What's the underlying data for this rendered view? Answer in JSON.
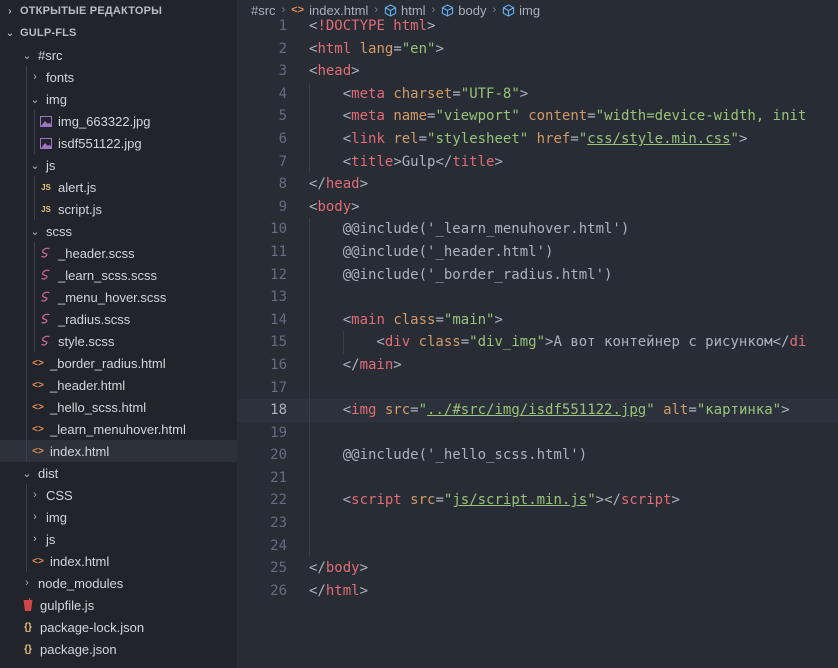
{
  "sidebar": {
    "open_editors_label": "ОТКРЫТЫЕ РЕДАКТОРЫ",
    "project_label": "GULP-FLS",
    "tree": [
      {
        "label": "#src",
        "depth": 1,
        "kind": "folder-open"
      },
      {
        "label": "fonts",
        "depth": 2,
        "kind": "folder-closed"
      },
      {
        "label": "img",
        "depth": 2,
        "kind": "folder-open"
      },
      {
        "label": "img_663322.jpg",
        "depth": 3,
        "kind": "image"
      },
      {
        "label": "isdf551122.jpg",
        "depth": 3,
        "kind": "image"
      },
      {
        "label": "js",
        "depth": 2,
        "kind": "folder-open"
      },
      {
        "label": "alert.js",
        "depth": 3,
        "kind": "js"
      },
      {
        "label": "script.js",
        "depth": 3,
        "kind": "js"
      },
      {
        "label": "scss",
        "depth": 2,
        "kind": "folder-open"
      },
      {
        "label": "_header.scss",
        "depth": 3,
        "kind": "scss"
      },
      {
        "label": "_learn_scss.scss",
        "depth": 3,
        "kind": "scss"
      },
      {
        "label": "_menu_hover.scss",
        "depth": 3,
        "kind": "scss"
      },
      {
        "label": "_radius.scss",
        "depth": 3,
        "kind": "scss"
      },
      {
        "label": "style.scss",
        "depth": 3,
        "kind": "scss"
      },
      {
        "label": "_border_radius.html",
        "depth": 2,
        "kind": "html"
      },
      {
        "label": "_header.html",
        "depth": 2,
        "kind": "html"
      },
      {
        "label": "_hello_scss.html",
        "depth": 2,
        "kind": "html"
      },
      {
        "label": "_learn_menuhover.html",
        "depth": 2,
        "kind": "html"
      },
      {
        "label": "index.html",
        "depth": 2,
        "kind": "html",
        "selected": true
      },
      {
        "label": "dist",
        "depth": 1,
        "kind": "folder-open"
      },
      {
        "label": "CSS",
        "depth": 2,
        "kind": "folder-closed"
      },
      {
        "label": "img",
        "depth": 2,
        "kind": "folder-closed"
      },
      {
        "label": "js",
        "depth": 2,
        "kind": "folder-closed"
      },
      {
        "label": "index.html",
        "depth": 2,
        "kind": "html"
      },
      {
        "label": "node_modules",
        "depth": 1,
        "kind": "folder-closed"
      },
      {
        "label": "gulpfile.js",
        "depth": 1,
        "kind": "gulp"
      },
      {
        "label": "package-lock.json",
        "depth": 1,
        "kind": "json"
      },
      {
        "label": "package.json",
        "depth": 1,
        "kind": "json"
      }
    ]
  },
  "breadcrumb": {
    "items": [
      {
        "label": "#src",
        "icon": "none"
      },
      {
        "label": "index.html",
        "icon": "html-icon"
      },
      {
        "label": "html",
        "icon": "cube-icon"
      },
      {
        "label": "body",
        "icon": "cube-icon"
      },
      {
        "label": "img",
        "icon": "cube-icon"
      }
    ]
  },
  "editor": {
    "current_line": 18,
    "lines": [
      {
        "n": "1",
        "tokens": [
          [
            "p",
            "<"
          ],
          [
            "t",
            "!DOCTYPE html"
          ],
          [
            "p",
            ">"
          ]
        ]
      },
      {
        "n": "2",
        "tokens": [
          [
            "p",
            "<"
          ],
          [
            "t",
            "html "
          ],
          [
            "a",
            "lang"
          ],
          [
            "p",
            "="
          ],
          [
            "s",
            "\"en\""
          ],
          [
            "p",
            ">"
          ]
        ]
      },
      {
        "n": "3",
        "tokens": [
          [
            "p",
            "<"
          ],
          [
            "t",
            "head"
          ],
          [
            "p",
            ">"
          ]
        ]
      },
      {
        "n": "4",
        "tokens": [
          [
            "p",
            "    <"
          ],
          [
            "t",
            "meta "
          ],
          [
            "a",
            "charset"
          ],
          [
            "p",
            "="
          ],
          [
            "s",
            "\"UTF-8\""
          ],
          [
            "p",
            ">"
          ]
        ]
      },
      {
        "n": "5",
        "tokens": [
          [
            "p",
            "    <"
          ],
          [
            "t",
            "meta "
          ],
          [
            "a",
            "name"
          ],
          [
            "p",
            "="
          ],
          [
            "s",
            "\"viewport\""
          ],
          [
            "p",
            " "
          ],
          [
            "a",
            "content"
          ],
          [
            "p",
            "="
          ],
          [
            "s",
            "\"width=device-width, init"
          ]
        ]
      },
      {
        "n": "6",
        "tokens": [
          [
            "p",
            "    <"
          ],
          [
            "t",
            "link "
          ],
          [
            "a",
            "rel"
          ],
          [
            "p",
            "="
          ],
          [
            "s",
            "\"stylesheet\""
          ],
          [
            "p",
            " "
          ],
          [
            "a",
            "href"
          ],
          [
            "p",
            "="
          ],
          [
            "s",
            "\""
          ],
          [
            "u",
            "css/style.min.css"
          ],
          [
            "s",
            "\""
          ],
          [
            "p",
            ">"
          ]
        ]
      },
      {
        "n": "7",
        "tokens": [
          [
            "p",
            "    <"
          ],
          [
            "t",
            "title"
          ],
          [
            "p",
            ">Gulp</"
          ],
          [
            "t",
            "title"
          ],
          [
            "p",
            ">"
          ]
        ]
      },
      {
        "n": "8",
        "tokens": [
          [
            "p",
            "</"
          ],
          [
            "t",
            "head"
          ],
          [
            "p",
            ">"
          ]
        ]
      },
      {
        "n": "9",
        "tokens": [
          [
            "p",
            "<"
          ],
          [
            "t",
            "body"
          ],
          [
            "p",
            ">"
          ]
        ]
      },
      {
        "n": "10",
        "tokens": [
          [
            "p",
            "    @@include('_learn_menuhover.html')"
          ]
        ]
      },
      {
        "n": "11",
        "tokens": [
          [
            "p",
            "    @@include('_header.html')"
          ]
        ]
      },
      {
        "n": "12",
        "tokens": [
          [
            "p",
            "    @@include('_border_radius.html')"
          ]
        ]
      },
      {
        "n": "13",
        "tokens": []
      },
      {
        "n": "14",
        "tokens": [
          [
            "p",
            "    <"
          ],
          [
            "t",
            "main "
          ],
          [
            "a",
            "class"
          ],
          [
            "p",
            "="
          ],
          [
            "s",
            "\"main\""
          ],
          [
            "p",
            ">"
          ]
        ]
      },
      {
        "n": "15",
        "tokens": [
          [
            "p",
            "        <"
          ],
          [
            "t",
            "div "
          ],
          [
            "a",
            "class"
          ],
          [
            "p",
            "="
          ],
          [
            "s",
            "\"div_img\""
          ],
          [
            "p",
            ">А вот контейнер с рисунком</"
          ],
          [
            "t",
            "di"
          ]
        ]
      },
      {
        "n": "16",
        "tokens": [
          [
            "p",
            "    </"
          ],
          [
            "t",
            "main"
          ],
          [
            "p",
            ">"
          ]
        ]
      },
      {
        "n": "17",
        "tokens": []
      },
      {
        "n": "18",
        "tokens": [
          [
            "p",
            "    <"
          ],
          [
            "t",
            "img "
          ],
          [
            "a",
            "src"
          ],
          [
            "p",
            "="
          ],
          [
            "s",
            "\""
          ],
          [
            "u",
            "../#src/img/isdf551122.jpg"
          ],
          [
            "s",
            "\""
          ],
          [
            "p",
            " "
          ],
          [
            "a",
            "alt"
          ],
          [
            "p",
            "="
          ],
          [
            "s",
            "\"картинка\""
          ],
          [
            "p",
            ">"
          ]
        ]
      },
      {
        "n": "19",
        "tokens": []
      },
      {
        "n": "20",
        "tokens": [
          [
            "p",
            "    @@include('_hello_scss.html')"
          ]
        ]
      },
      {
        "n": "21",
        "tokens": []
      },
      {
        "n": "22",
        "tokens": [
          [
            "p",
            "    <"
          ],
          [
            "t",
            "script "
          ],
          [
            "a",
            "src"
          ],
          [
            "p",
            "="
          ],
          [
            "s",
            "\""
          ],
          [
            "u",
            "js/script.min.js"
          ],
          [
            "s",
            "\""
          ],
          [
            "p",
            "></"
          ],
          [
            "t",
            "script"
          ],
          [
            "p",
            ">"
          ]
        ]
      },
      {
        "n": "23",
        "tokens": []
      },
      {
        "n": "24",
        "tokens": []
      },
      {
        "n": "25",
        "tokens": [
          [
            "p",
            "</"
          ],
          [
            "t",
            "body"
          ],
          [
            "p",
            ">"
          ]
        ]
      },
      {
        "n": "26",
        "tokens": [
          [
            "p",
            "</"
          ],
          [
            "t",
            "html"
          ],
          [
            "p",
            ">"
          ]
        ]
      }
    ]
  },
  "colors": {
    "tag": "#e06c75",
    "attribute": "#d19a66",
    "string": "#98c379",
    "plain": "#abb2bf",
    "line_number": "#636d83",
    "editor_bg": "#282c34",
    "sidebar_bg": "#21252b"
  }
}
